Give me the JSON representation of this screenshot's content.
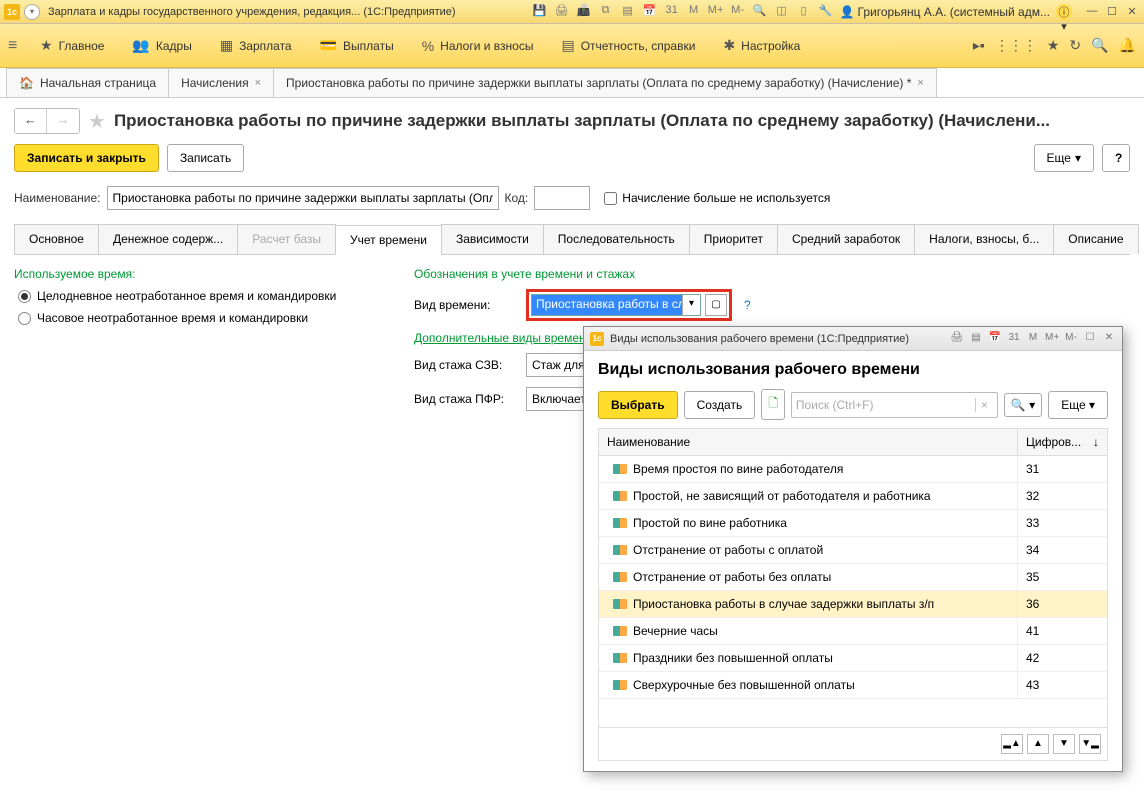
{
  "titlebar": {
    "app_title": "Зарплата и кадры государственного учреждения, редакция...  (1С:Предприятие)",
    "user": "Григорьянц А.А. (системный адм...",
    "icons": {
      "m": "M",
      "mplus": "M+",
      "mminus": "M-"
    }
  },
  "menu": {
    "items": [
      {
        "label": "Главное",
        "icon": "≡"
      },
      {
        "label": "Кадры",
        "icon": "👥"
      },
      {
        "label": "Зарплата",
        "icon": "▦"
      },
      {
        "label": "Выплаты",
        "icon": "💳"
      },
      {
        "label": "Налоги и взносы",
        "icon": "%"
      },
      {
        "label": "Отчетность, справки",
        "icon": "▤"
      },
      {
        "label": "Настройка",
        "icon": "✱"
      }
    ]
  },
  "tabs": {
    "t0": {
      "label": "Начальная страница"
    },
    "t1": {
      "label": "Начисления"
    },
    "t2": {
      "label": "Приостановка работы по причине задержки выплаты зарплаты (Оплата по среднему заработку) (Начисление) *"
    }
  },
  "page": {
    "title": "Приостановка работы по причине задержки выплаты зарплаты (Оплата по среднему заработку) (Начислени...",
    "save_close": "Записать и закрыть",
    "save": "Записать",
    "more": "Еще",
    "help": "?"
  },
  "fields": {
    "name_label": "Наименование:",
    "name_value": "Приостановка работы по причине задержки выплаты зарплаты (Опл",
    "code_label": "Код:",
    "not_used": "Начисление больше не используется"
  },
  "subtabs": [
    "Основное",
    "Денежное содерж...",
    "Расчет базы",
    "Учет времени",
    "Зависимости",
    "Последовательность",
    "Приоритет",
    "Средний заработок",
    "Налоги, взносы, б...",
    "Описание"
  ],
  "form": {
    "used_time": "Используемое время:",
    "radio1": "Целодневное неотработанное время и командировки",
    "radio2": "Часовое неотработанное время и командировки",
    "markers": "Обозначения в учете времени и стажах",
    "vid_vremeni": "Вид времени:",
    "vid_vremeni_val": "Приостановка работы в сл",
    "extra_link": "Дополнительные виды времен",
    "szv_label": "Вид стажа СЗВ:",
    "szv_val": "Стаж для до",
    "pfr_label": "Вид стажа ПФР:",
    "pfr_val": "Включается"
  },
  "popup": {
    "window_title": "Виды использования рабочего времени  (1С:Предприятие)",
    "heading": "Виды использования рабочего времени",
    "select": "Выбрать",
    "create": "Создать",
    "search_ph": "Поиск (Ctrl+F)",
    "more": "Еще",
    "col_name": "Наименование",
    "col_code": "Цифров...",
    "rows": [
      {
        "name": "Время простоя по вине работодателя",
        "code": "31"
      },
      {
        "name": "Простой, не зависящий от работодателя и работника",
        "code": "32"
      },
      {
        "name": "Простой по вине работника",
        "code": "33"
      },
      {
        "name": "Отстранение от работы с оплатой",
        "code": "34"
      },
      {
        "name": "Отстранение от работы без оплаты",
        "code": "35"
      },
      {
        "name": "Приостановка работы в случае задержки выплаты з/п",
        "code": "36",
        "selected": true
      },
      {
        "name": "Вечерние часы",
        "code": "41"
      },
      {
        "name": "Праздники без повышенной оплаты",
        "code": "42"
      },
      {
        "name": "Сверхурочные без повышенной оплаты",
        "code": "43"
      }
    ]
  }
}
